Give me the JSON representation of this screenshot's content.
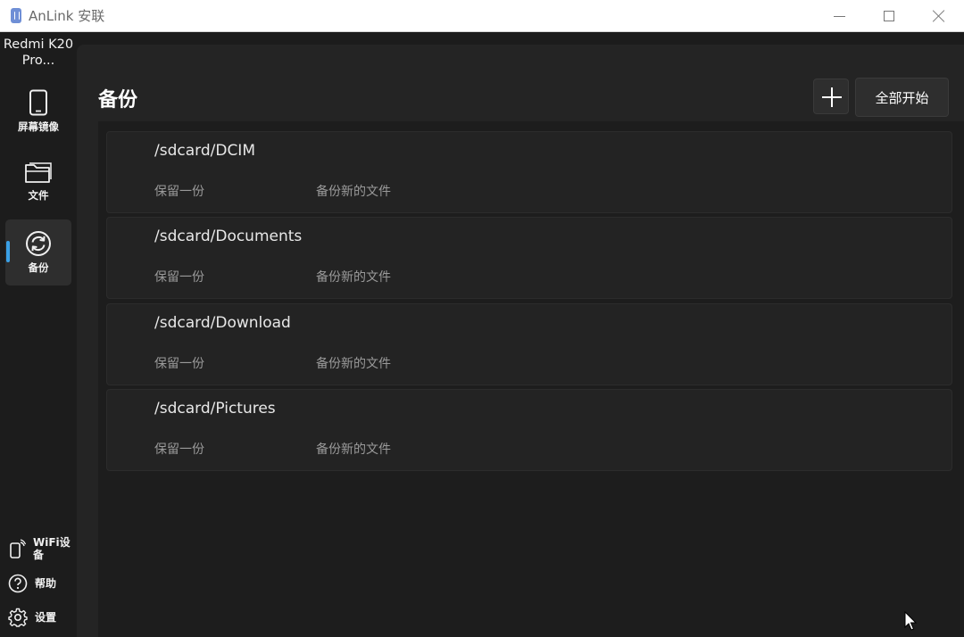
{
  "titlebar": {
    "app_title": "AnLink 安联",
    "icons": {
      "app": "anlink-app-icon",
      "minimize": "minimize-icon",
      "maximize": "maximize-icon",
      "close": "close-icon"
    }
  },
  "sidebar": {
    "device_name_line1": "Redmi K20",
    "device_name_line2": "Pro...",
    "nav": [
      {
        "label": "屏幕镜像",
        "icon": "phone-icon",
        "active": false
      },
      {
        "label": "文件",
        "icon": "folder-icon",
        "active": false
      },
      {
        "label": "备份",
        "icon": "sync-icon",
        "active": true
      }
    ],
    "bottom": [
      {
        "label_line1": "WiFi设",
        "label_line2": "备",
        "icon": "wifi-device-icon"
      },
      {
        "label": "帮助",
        "icon": "help-icon"
      },
      {
        "label": "设置",
        "icon": "gear-icon"
      }
    ]
  },
  "main": {
    "title": "备份",
    "add_button_icon": "plus-icon",
    "start_all_label": "全部开始",
    "folders": [
      {
        "path": "/sdcard/DCIM",
        "keep": "保留一份",
        "mode": "备份新的文件"
      },
      {
        "path": "/sdcard/Documents",
        "keep": "保留一份",
        "mode": "备份新的文件"
      },
      {
        "path": "/sdcard/Download",
        "keep": "保留一份",
        "mode": "备份新的文件"
      },
      {
        "path": "/sdcard/Pictures",
        "keep": "保留一份",
        "mode": "备份新的文件"
      }
    ]
  },
  "colors": {
    "accent": "#3aa0e6",
    "background": "#1c1c1c",
    "panel": "#242424",
    "card": "#232323"
  }
}
